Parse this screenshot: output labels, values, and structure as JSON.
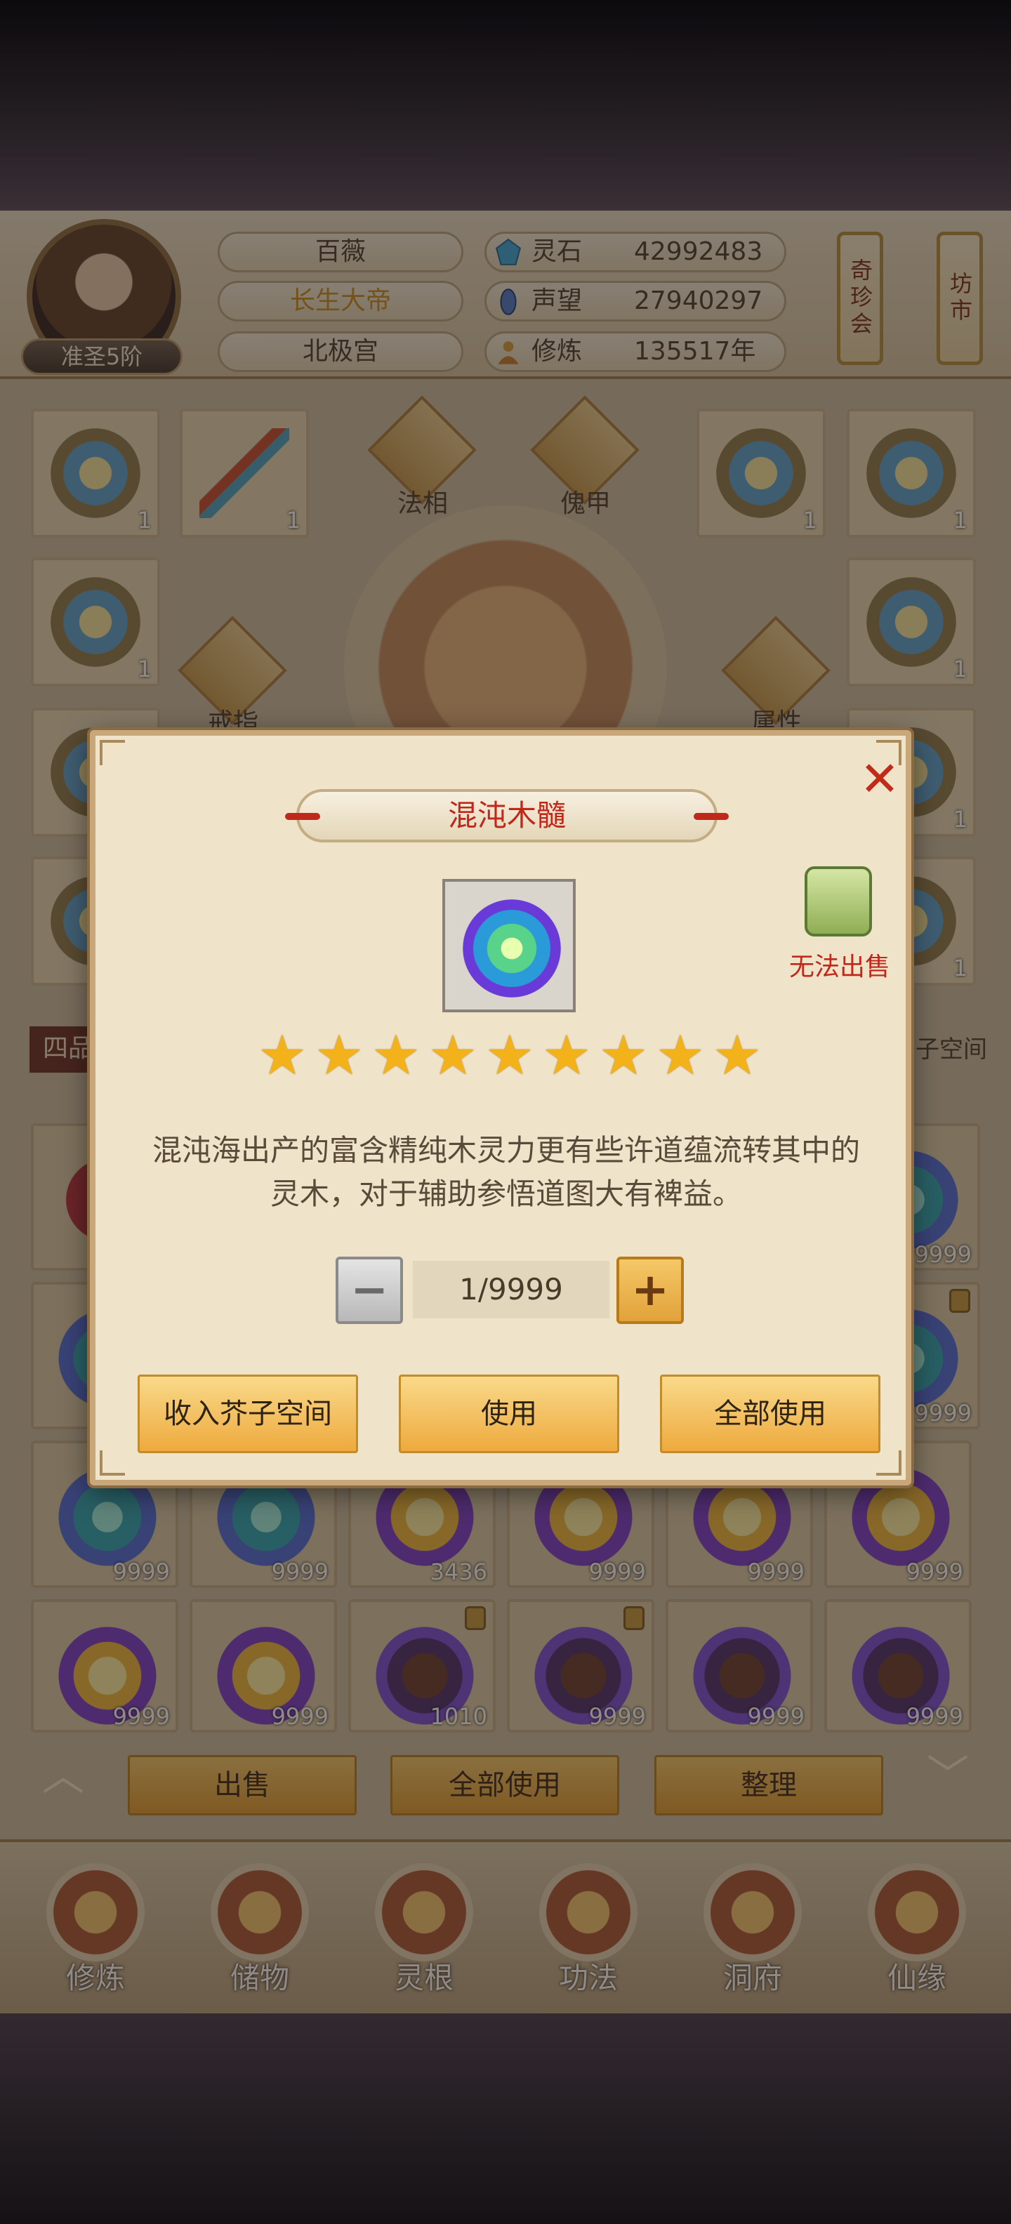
{
  "header": {
    "player_name": "百薇",
    "player_title": "长生大帝",
    "sect": "北极宫",
    "rank": "准圣5阶",
    "resources": [
      {
        "label": "灵石",
        "value": "42992483",
        "icon": "spirit-stone-icon"
      },
      {
        "label": "声望",
        "value": "27940297",
        "icon": "reputation-icon"
      },
      {
        "label": "修炼",
        "value": "135517年",
        "icon": "cultivation-icon"
      }
    ],
    "lanterns": [
      "奇珍会",
      "坊市"
    ]
  },
  "equipment": {
    "slots": [
      {
        "label": "法相"
      },
      {
        "label": "傀甲"
      },
      {
        "label": "戒指"
      },
      {
        "label": "属性"
      }
    ],
    "counts": [
      "1",
      "1",
      "1",
      "1",
      "1",
      "1",
      "1",
      "1",
      "1",
      "1"
    ],
    "section_label": "四品",
    "storage_label": "芥子空间"
  },
  "inventory": {
    "row1_counts": [
      "9999",
      "9999",
      "3436",
      "9999",
      "9999",
      "9999"
    ],
    "row2_counts": [
      "9999",
      "9999",
      "1010",
      "9999",
      "9999",
      "9999"
    ],
    "side_counts": [
      "9999",
      "9999"
    ]
  },
  "bottom_actions": {
    "sell": "出售",
    "use_all": "全部使用",
    "sort": "整理"
  },
  "nav": [
    {
      "label": "修炼",
      "icon": "cultivate-icon"
    },
    {
      "label": "储物",
      "icon": "storage-bag-icon"
    },
    {
      "label": "灵根",
      "icon": "spirit-root-icon"
    },
    {
      "label": "功法",
      "icon": "technique-book-icon"
    },
    {
      "label": "洞府",
      "icon": "cave-residence-icon"
    },
    {
      "label": "仙缘",
      "icon": "immortal-fate-icon"
    }
  ],
  "dialog": {
    "title": "混沌木髓",
    "lock_text": "无法出售",
    "star_count": 9,
    "description": "混沌海出产的富含精纯木灵力更有些许道蕴流转其中的灵木，对于辅助参悟道图大有裨益。",
    "quantity": "1/9999",
    "buttons": {
      "store": "收入芥子空间",
      "use": "使用",
      "use_all": "全部使用"
    }
  }
}
